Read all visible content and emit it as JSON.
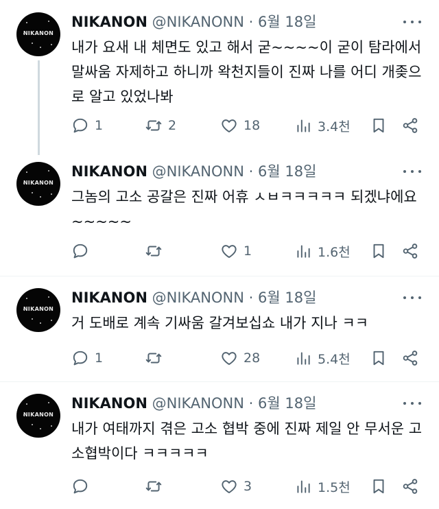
{
  "tweets": [
    {
      "name": "NIKANON",
      "handle": "@NIKANONN",
      "sep": "·",
      "date": "6월 18일",
      "text": "내가 요새 내 체면도 있고 해서 굳~~~~이 굳이 탐라에서 말싸움 자제하고 하니까 왁천지들이 진짜 나를 어디 개좆으로 알고 있었나봐",
      "avatar_text": "NIKANON",
      "replies": "1",
      "retweets": "2",
      "likes": "18",
      "views": "3.4천"
    },
    {
      "name": "NIKANON",
      "handle": "@NIKANONN",
      "sep": "·",
      "date": "6월 18일",
      "text": "그놈의 고소 공갈은 진짜 어휴 ㅅㅂㅋㅋㅋㅋㅋ 되겠냐에요~~~~~",
      "avatar_text": "NIKANON",
      "replies": "",
      "retweets": "",
      "likes": "1",
      "views": "1.6천"
    },
    {
      "name": "NIKANON",
      "handle": "@NIKANONN",
      "sep": "·",
      "date": "6월 18일",
      "text": "거 도배로 계속 기싸움 갈겨보십쇼 내가 지나 ㅋㅋ",
      "avatar_text": "NIKANON",
      "replies": "1",
      "retweets": "",
      "likes": "28",
      "views": "5.4천"
    },
    {
      "name": "NIKANON",
      "handle": "@NIKANONN",
      "sep": "·",
      "date": "6월 18일",
      "text": "내가 여태까지 겪은 고소 협박 중에 진짜 제일 안 무서운 고소협박이다 ㅋㅋㅋㅋㅋ",
      "avatar_text": "NIKANON",
      "replies": "",
      "retweets": "",
      "likes": "3",
      "views": "1.5천"
    }
  ],
  "colors": {
    "text": "#0f1419",
    "secondary": "#536471",
    "divider": "#eff3f4",
    "thread_line": "#cfd9de",
    "avatar_bg": "#050505"
  },
  "icons": [
    "reply-icon",
    "retweet-icon",
    "like-icon",
    "views-icon",
    "bookmark-icon",
    "share-icon",
    "more-icon"
  ]
}
